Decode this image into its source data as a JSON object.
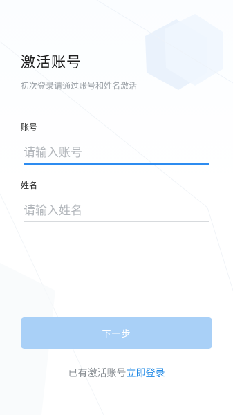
{
  "page": {
    "title": "激活账号",
    "subtitle": "初次登录请通过账号和姓名激活"
  },
  "form": {
    "account_label": "账号",
    "account_placeholder": "请输入账号",
    "name_label": "姓名",
    "name_placeholder": "请输入姓名",
    "next_label": "下一步"
  },
  "footer": {
    "prefix": "已有激活账号",
    "login_link": "立即登录"
  },
  "colors": {
    "accent": "#2d8cf0",
    "button_disabled": "#a9d0f7",
    "link": "#1e88e5"
  }
}
